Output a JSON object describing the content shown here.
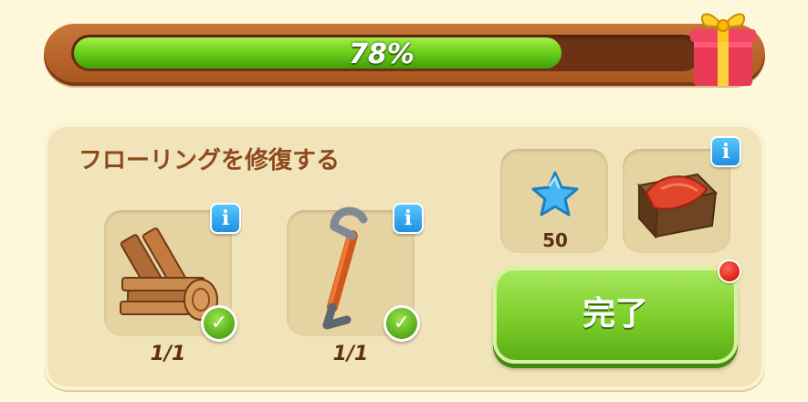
{
  "progress": {
    "percent_label": "78%",
    "fraction": 0.78
  },
  "task": {
    "title": "フローリングを修復する",
    "requirements": [
      {
        "icon": "wooden-planks-icon",
        "count": "1/1",
        "completed": true
      },
      {
        "icon": "crowbar-icon",
        "count": "1/1",
        "completed": true
      }
    ]
  },
  "rewards": [
    {
      "icon": "blue-star-icon",
      "count": "50"
    },
    {
      "icon": "crate-with-red-cloth-icon",
      "count": ""
    }
  ],
  "buttons": {
    "complete_label": "完了",
    "info_glyph": "i",
    "check_glyph": "✓"
  },
  "colors": {
    "progress_fill": "#6dd11a",
    "title_text": "#8e4a1d",
    "complete_button": "#7ccd2b",
    "info_badge": "#1f8fe0",
    "notify_dot": "#d51a10"
  }
}
